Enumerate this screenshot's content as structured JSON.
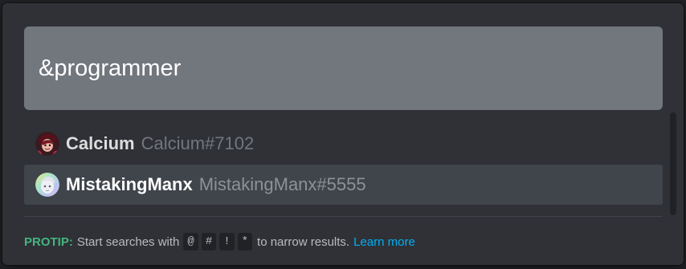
{
  "search": {
    "value": "&programmer"
  },
  "results": [
    {
      "name": "Calcium",
      "tag": "Calcium#7102",
      "avatar": "calcium-avatar-icon",
      "selected": false
    },
    {
      "name": "MistakingManx",
      "tag": "MistakingManx#5555",
      "avatar": "mistakingmanx-avatar-icon",
      "selected": true
    }
  ],
  "protip": {
    "label": "PROTIP:",
    "text_before": "Start searches with",
    "keys": [
      "@",
      "#",
      "!",
      "*"
    ],
    "text_after": "to narrow results.",
    "link": "Learn more"
  },
  "colors": {
    "background": "#2f3136",
    "search_box": "#72767d",
    "selected_row": "#40444b",
    "protip_accent": "#43b581",
    "link": "#00b0f4"
  }
}
